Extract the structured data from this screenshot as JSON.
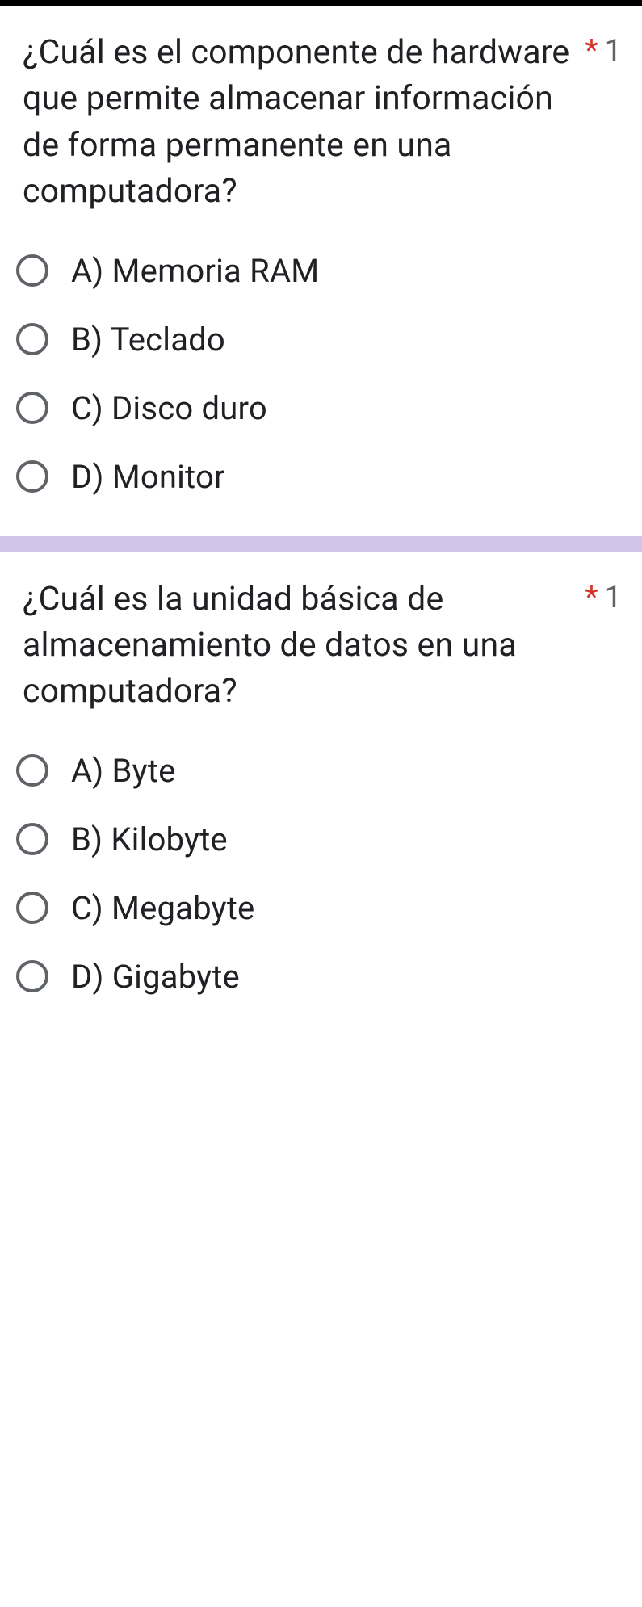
{
  "required_mark": "*",
  "questions": [
    {
      "text": "¿Cuál es el componente de hardware que permite almacenar información de forma permanente en una computadora?",
      "points": "1",
      "options": [
        "A) Memoria RAM",
        "B) Teclado",
        "C) Disco duro",
        "D) Monitor"
      ]
    },
    {
      "text": "¿Cuál es la unidad básica de almacenamiento de datos en una computadora?",
      "points": "1",
      "options": [
        "A) Byte",
        "B) Kilobyte",
        "C) Megabyte",
        "D) Gigabyte"
      ]
    }
  ]
}
